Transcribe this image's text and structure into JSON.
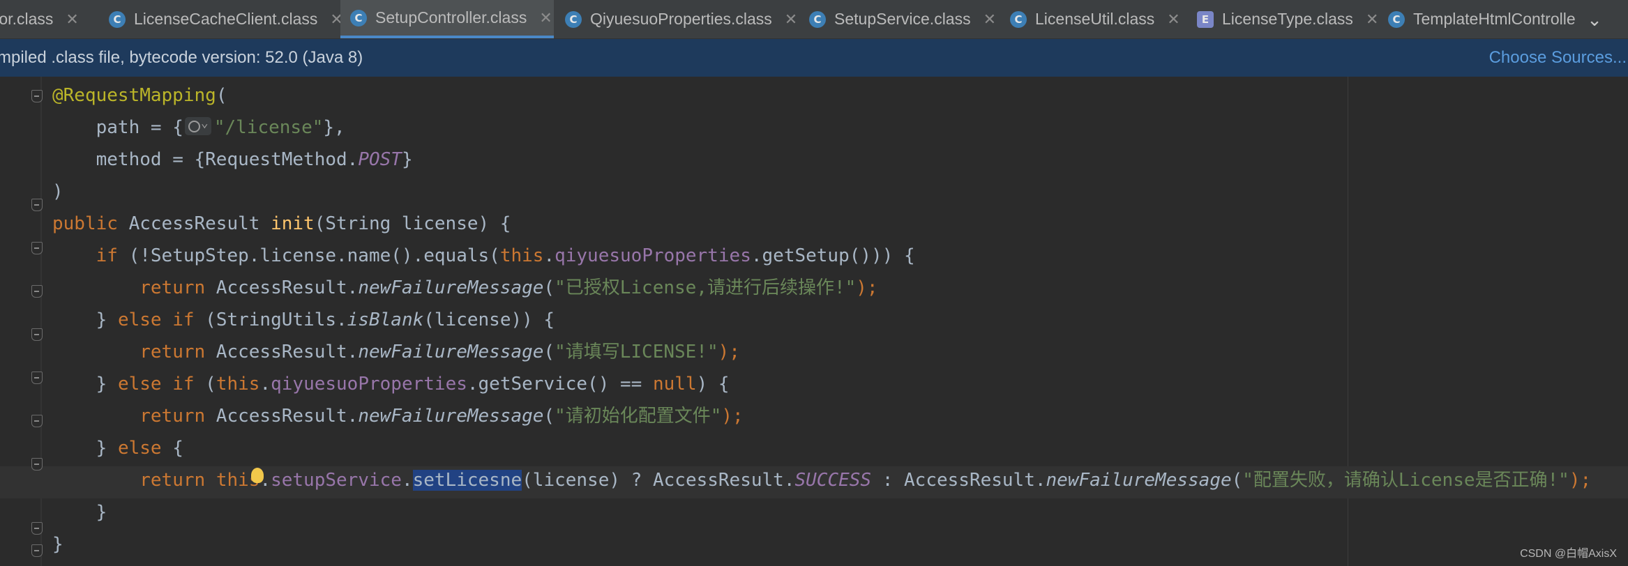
{
  "tabs": [
    {
      "label": "tor.class",
      "icon": "class-icon",
      "active": false
    },
    {
      "label": "LicenseCacheClient.class",
      "icon": "class-icon",
      "active": false
    },
    {
      "label": "SetupController.class",
      "icon": "class-icon",
      "active": true
    },
    {
      "label": "QiyuesuoProperties.class",
      "icon": "class-icon",
      "active": false
    },
    {
      "label": "SetupService.class",
      "icon": "class-icon",
      "active": false
    },
    {
      "label": "LicenseUtil.class",
      "icon": "class-icon",
      "active": false
    },
    {
      "label": "LicenseType.class",
      "icon": "enum-icon",
      "active": false
    },
    {
      "label": "TemplateHtmlControlle",
      "icon": "class-icon",
      "active": false
    }
  ],
  "tab_icon_letters": {
    "class": "C",
    "enum": "E"
  },
  "banner": {
    "message": "mpiled .class file, bytecode version: 52.0 (Java 8)",
    "action": "Choose Sources..."
  },
  "code": {
    "l1": {
      "annotation": "@RequestMapping",
      "open": "("
    },
    "l2": {
      "indent": "    ",
      "a": "path = {",
      "b": "\"/license\"",
      "c": "},"
    },
    "l3": {
      "indent": "    ",
      "a": "method = {RequestMethod.",
      "b": "POST",
      "c": "}"
    },
    "l4": {
      "a": ")"
    },
    "l5": {
      "k1": "public",
      "a": " AccessResult ",
      "fn": "init",
      "b": "(String license) {"
    },
    "l6": {
      "indent": "    ",
      "k1": "if",
      "a": " (!SetupStep.license.name().equals(",
      "k2": "this",
      "a2": ".",
      "f1": "qiyuesuoProperties",
      "b": ".getSetup())) {"
    },
    "l7": {
      "indent": "        ",
      "k1": "return",
      "a": " AccessResult.",
      "it": "newFailureMessage",
      "b": "(",
      "s": "\"已授权License,请进行后续操作!\"",
      "c": ");"
    },
    "l8": {
      "indent": "    ",
      "a": "} ",
      "k1": "else if",
      "b": " (StringUtils.",
      "it": "isBlank",
      "c": "(license)) {"
    },
    "l9": {
      "indent": "        ",
      "k1": "return",
      "a": " AccessResult.",
      "it": "newFailureMessage",
      "b": "(",
      "s": "\"请填写LICENSE!\"",
      "c": ");"
    },
    "l10": {
      "indent": "    ",
      "a": "} ",
      "k1": "else if",
      "b": " (",
      "k2": "this",
      "b2": ".",
      "f1": "qiyuesuoProperties",
      "c": ".getService() == ",
      "k3": "null",
      "d": ") {"
    },
    "l11": {
      "indent": "        ",
      "k1": "return",
      "a": " AccessResult.",
      "it": "newFailureMessage",
      "b": "(",
      "s": "\"请初始化配置文件\"",
      "c": ");"
    },
    "l12": {
      "indent": "    ",
      "a": "} ",
      "k1": "else",
      "b": " {"
    },
    "l13": {
      "indent": "        ",
      "k1": "return",
      "sp": " ",
      "k2": "this",
      "dot": ".",
      "f1": "setupService",
      "a": ".",
      "sel": "setLicesne",
      "b": "(license) ? AccessResult.",
      "st": "SUCCESS",
      "c": " : AccessResult.",
      "it": "newFailureMessage",
      "d": "(",
      "s": "\"配置失败，请确认License是否正确!\"",
      "e": ");"
    },
    "l14": {
      "indent": "    ",
      "a": "}"
    },
    "l15": {
      "a": "}"
    }
  },
  "watermark": "CSDN @白帽AxisX",
  "colors": {
    "keyword": "#cc7832",
    "annotation": "#bbb529",
    "string": "#6a8759",
    "field": "#9876aa",
    "method_decl": "#ffc66d",
    "selection": "#214283"
  }
}
